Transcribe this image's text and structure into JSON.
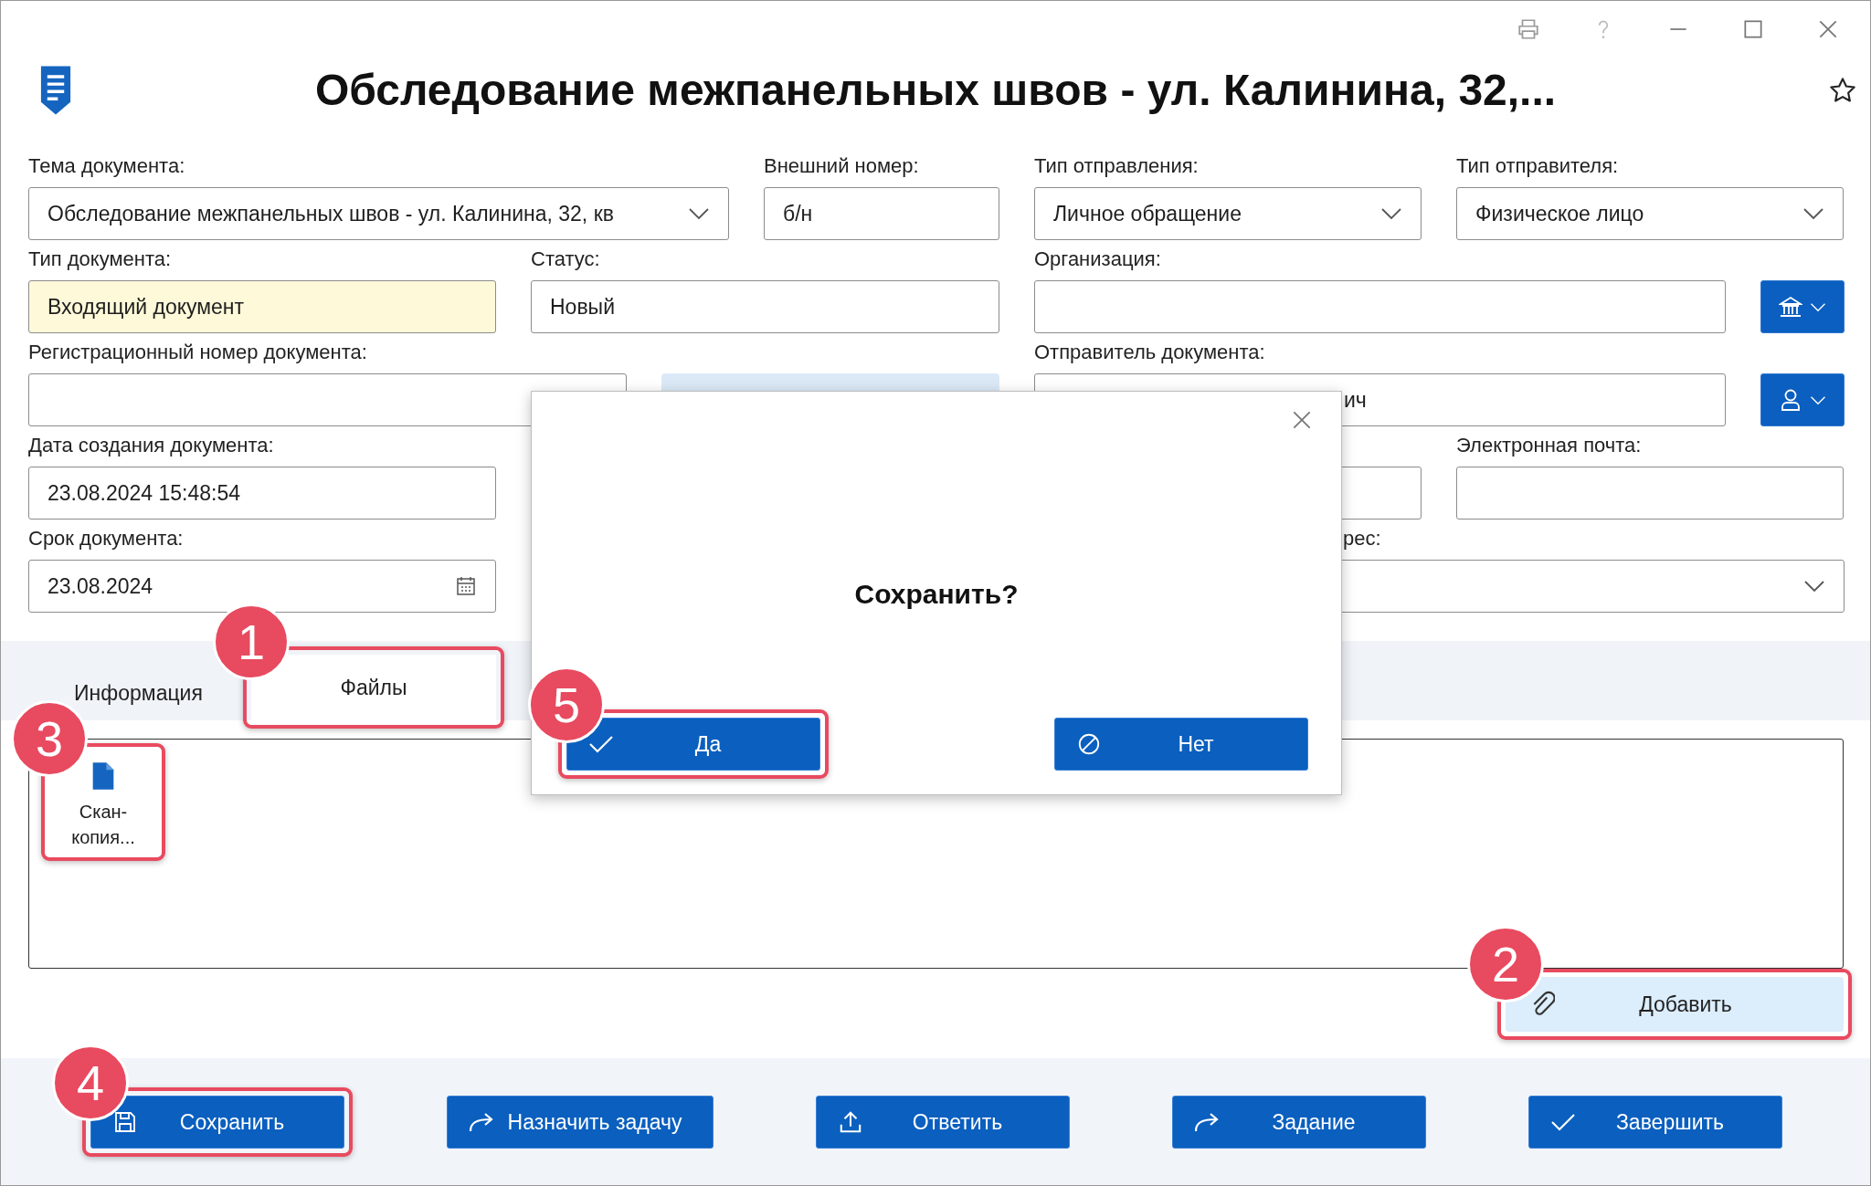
{
  "title": "Обследование межпанельных швов - ул. Калинина, 32,...",
  "form": {
    "fields": [
      {
        "label": "Тема документа:",
        "value": "Обследование межпанельных швов - ул. Калинина, 32, кв",
        "kind": "dropdown"
      },
      {
        "label": "Внешний номер:",
        "value": "б/н",
        "kind": "text"
      },
      {
        "label": "Тип отправления:",
        "value": "Личное обращение",
        "kind": "dropdown"
      },
      {
        "label": "Тип отправителя:",
        "value": "Физическое лицо",
        "kind": "dropdown"
      },
      {
        "label": "Тип документа:",
        "value": "Входящий документ",
        "kind": "text",
        "highlighted": true
      },
      {
        "label": "Статус:",
        "value": "Новый",
        "kind": "text"
      },
      {
        "label": "Организация:",
        "kind": "text"
      },
      {
        "kind": "org-picker"
      },
      {
        "label": "Регистрационный номер документа:",
        "kind": "text"
      },
      {
        "kind": "action"
      },
      {
        "label": "Отправитель документа:",
        "value": "ич",
        "kind": "text"
      },
      {
        "kind": "person-picker"
      },
      {
        "label": "Дата создания документа:",
        "value": "23.08.2024 15:48:54",
        "kind": "text"
      },
      {
        "kind": "text"
      },
      {
        "label": "Электронная почта:",
        "kind": "text"
      },
      {
        "label": "Срок документа:",
        "value": "23.08.2024",
        "kind": "date"
      },
      {
        "label": "рес:",
        "kind": "dropdown"
      }
    ]
  },
  "tabs": [
    {
      "label": "Информация",
      "selected": false
    },
    {
      "label": "Файлы",
      "selected": true,
      "callout": "1"
    }
  ],
  "files": [
    {
      "name": "Скан-копия...",
      "callout": "3"
    }
  ],
  "add_button": {
    "label": "Добавить",
    "callout": "2"
  },
  "actions": [
    {
      "label": "Сохранить",
      "kind": "save",
      "callout": "4"
    },
    {
      "label": "Назначить задачу",
      "kind": "assign"
    },
    {
      "label": "Ответить",
      "kind": "upload"
    },
    {
      "label": "Задание",
      "kind": "forward"
    },
    {
      "label": "Завершить",
      "kind": "check"
    }
  ],
  "dialog": {
    "message": "Сохранить?",
    "buttons": [
      {
        "label": "Да",
        "kind": "confirm",
        "callout": "5"
      },
      {
        "label": "Нет",
        "kind": "cancel"
      }
    ]
  }
}
